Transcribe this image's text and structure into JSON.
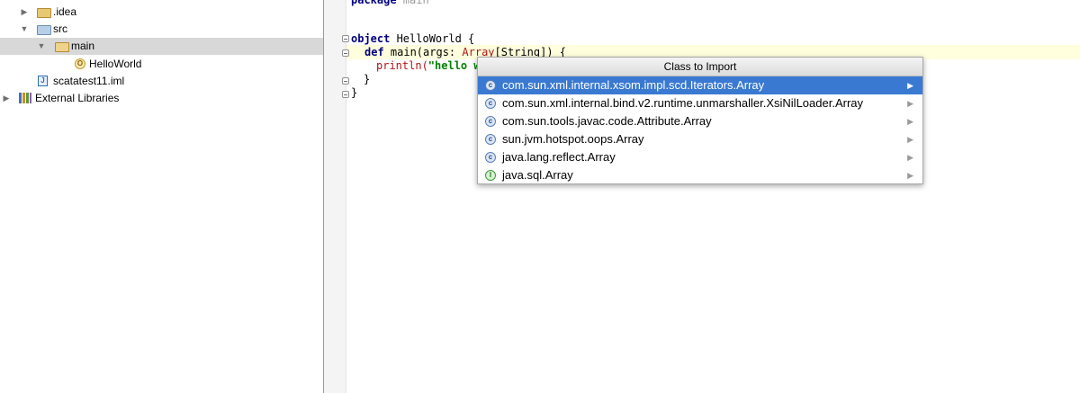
{
  "project_tree": {
    "items": [
      {
        "label": ".idea",
        "icon": "folder-icon",
        "arrow": "▶"
      },
      {
        "label": "src",
        "icon": "source-folder-icon",
        "arrow": "▼"
      },
      {
        "label": "main",
        "icon": "package-folder-icon",
        "arrow": "▼"
      },
      {
        "label": "HelloWorld",
        "icon": "scala-object-icon",
        "icon_glyph": "O"
      },
      {
        "label": "scatatest11.iml",
        "icon": "module-file-icon",
        "icon_glyph": "J"
      },
      {
        "label": "External Libraries",
        "icon": "libraries-icon",
        "arrow": "▶"
      }
    ]
  },
  "editor": {
    "lines": {
      "package_kw": "package",
      "package_name": " main",
      "object_kw": "object",
      "object_name": " HelloWorld {",
      "def_kw": "def",
      "def_sig": " main(args: ",
      "def_type": "Array",
      "def_rest": "[String]) {",
      "println": "println(",
      "string": "\"hello w",
      "close_inner": "}",
      "close_outer": "}"
    }
  },
  "import_popup": {
    "title": "Class to Import",
    "selected_index": 0,
    "submenu_arrow": "▶",
    "items": [
      {
        "label": "com.sun.xml.internal.xsom.impl.scd.Iterators.Array",
        "icon": "class-icon",
        "glyph": "c"
      },
      {
        "label": "com.sun.xml.internal.bind.v2.runtime.unmarshaller.XsiNilLoader.Array",
        "icon": "class-icon",
        "glyph": "c"
      },
      {
        "label": "com.sun.tools.javac.code.Attribute.Array",
        "icon": "class-icon",
        "glyph": "c"
      },
      {
        "label": "sun.jvm.hotspot.oops.Array",
        "icon": "class-icon",
        "glyph": "c"
      },
      {
        "label": "java.lang.reflect.Array",
        "icon": "class-icon",
        "glyph": "c"
      },
      {
        "label": "java.sql.Array",
        "icon": "interface-icon",
        "glyph": "I"
      }
    ]
  },
  "colors": {
    "selection": "#3a79d1",
    "keyword": "#000080",
    "string": "#008000",
    "type_error": "#b21616"
  }
}
